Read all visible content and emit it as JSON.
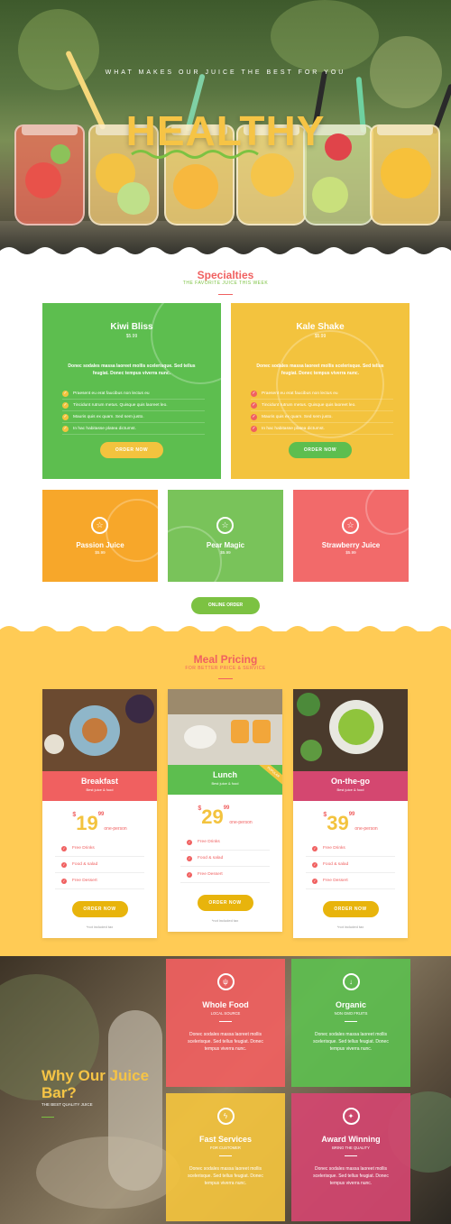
{
  "hero": {
    "subtitle": "WHAT MAKES OUR JUICE THE BEST FOR YOU",
    "title": "HEALTHY"
  },
  "specialties": {
    "title": "Specialties",
    "subtitle": "THE FAVORITE JUICE THIS WEEK",
    "featured": [
      {
        "name": "Kiwi Bliss",
        "price": "$5.99",
        "description": "Donec sodales massa laoreet mollis scelerisque. Sed tellus feugiat. Donec tempus viverra nunc.",
        "features": [
          "Praesent eu erat faucibus non lectus eu",
          "Tincidunt rutrum metus. Quisque quis laoreet leo.",
          "Mauris quis ex quam. Sed sem justo.",
          "In hac habitasse platea dictumst."
        ],
        "button": "ORDER NOW"
      },
      {
        "name": "Kale Shake",
        "price": "$5.99",
        "description": "Donec sodales massa laoreet mollis scelerisque. Sed tellus feugiat. Donec tempus viverra nunc.",
        "features": [
          "Praesent eu erat faucibus non lectus eu",
          "Tincidunt rutrum metus. Quisque quis laoreet leo.",
          "Mauris quis ex quam. Sed sem justo.",
          "In hac habitasse platea dictumst."
        ],
        "button": "ORDER NOW"
      }
    ],
    "small": [
      {
        "name": "Passion Juice",
        "price": "$5.99"
      },
      {
        "name": "Pear Magic",
        "price": "$5.99"
      },
      {
        "name": "Strawberry Juice",
        "price": "$5.99"
      }
    ],
    "online_button": "ONLINE ORDER"
  },
  "pricing": {
    "title": "Meal Pricing",
    "subtitle": "FOR BETTER PRICE & SERVICE",
    "plans": [
      {
        "name": "Breakfast",
        "sub": "Best juice & food",
        "currency": "$",
        "amount": "19",
        "cents": "99",
        "per": "one-person",
        "features": [
          "Free Drinks",
          "Food & salad",
          "Free Dessert"
        ],
        "button": "ORDER NOW",
        "note": "*not included tax",
        "band_color": "#f06060"
      },
      {
        "name": "Lunch",
        "sub": "Best juice & food",
        "currency": "$",
        "amount": "29",
        "cents": "99",
        "per": "one-person",
        "features": [
          "Free Drinks",
          "Food & salad",
          "Free Dessert"
        ],
        "button": "ORDER NOW",
        "note": "*not included tax",
        "band_color": "#5dbe4f",
        "ribbon": "POPULAR"
      },
      {
        "name": "On-the-go",
        "sub": "Best juice & food",
        "currency": "$",
        "amount": "39",
        "cents": "99",
        "per": "one-person",
        "features": [
          "Free Drinks",
          "Food & salad",
          "Free Dessert"
        ],
        "button": "ORDER NOW",
        "note": "*not included tax",
        "band_color": "#d44770"
      }
    ]
  },
  "why": {
    "title": "Why Our Juice Bar?",
    "subtitle": "THE BEST QUALITY JUICE",
    "cards": [
      {
        "name": "Whole Food",
        "sub": "LOCAL SOURCE",
        "desc": "Donec sodales massa laoreet mollis scelerisque. Sed tellus feugiat. Donec tempus viverra nunc.",
        "icon": "food-icon"
      },
      {
        "name": "Organic",
        "sub": "NON GMO FRUITS",
        "desc": "Donec sodales massa laoreet mollis scelerisque. Sed tellus feugiat. Donec tempus viverra nunc.",
        "icon": "organic-icon"
      },
      {
        "name": "Fast Services",
        "sub": "FOR CUSTOMER",
        "desc": "Donec sodales massa laoreet mollis scelerisque. Sed tellus feugiat. Donec tempus viverra nunc.",
        "icon": "lightning-icon"
      },
      {
        "name": "Award Winning",
        "sub": "BRING THE QUALITY",
        "desc": "Donec sodales massa laoreet mollis scelerisque. Sed tellus feugiat. Donec tempus viverra nunc.",
        "icon": "award-icon"
      }
    ]
  },
  "colors": {
    "green": "#5dbe4f",
    "yellow": "#f3c33e",
    "red": "#f06060",
    "pink": "#d44770",
    "lime": "#7cc242",
    "pricing_bg": "#ffcb55"
  }
}
